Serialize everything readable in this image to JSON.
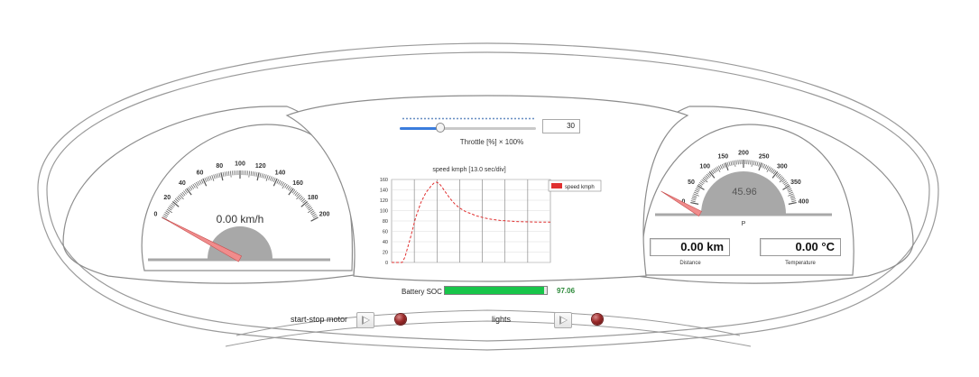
{
  "speedometer": {
    "readout": "0.00 km/h",
    "value": 0,
    "min": 0,
    "max": 200,
    "tick_labels": [
      "0",
      "20",
      "40",
      "60",
      "80",
      "100",
      "120",
      "140",
      "160",
      "180",
      "200"
    ]
  },
  "power_gauge": {
    "readout": "45.96",
    "value": 45.96,
    "min": 0,
    "max": 400,
    "unit_label": "P",
    "tick_labels": [
      "0",
      "50",
      "100",
      "150",
      "200",
      "250",
      "300",
      "350",
      "400"
    ]
  },
  "throttle": {
    "value": 30,
    "max": 100,
    "display": "30",
    "label": "Throttle [%] × 100%"
  },
  "chart_data": {
    "type": "line",
    "title": "speed kmph [13.0 sec/div]",
    "legend": [
      "speed kmph"
    ],
    "legend_placement": "top-right",
    "ylim": [
      0,
      160
    ],
    "yticks": [
      "160",
      "140",
      "120",
      "100",
      "80",
      "60",
      "40",
      "20",
      "0"
    ],
    "grid": true,
    "series": [
      {
        "name": "speed kmph",
        "color": "#e03030",
        "x": [
          0,
          4,
          8,
          10,
          14,
          18,
          22,
          26,
          30,
          32,
          34,
          36,
          38,
          40,
          44,
          48,
          52,
          56,
          60,
          64,
          70,
          76,
          82,
          88,
          94,
          100,
          110,
          120
        ],
        "values": [
          0,
          0,
          0,
          10,
          45,
          85,
          115,
          135,
          148,
          153,
          155,
          152,
          146,
          138,
          124,
          112,
          104,
          98,
          94,
          90,
          86,
          83,
          81,
          80,
          79,
          78.5,
          78,
          78
        ]
      }
    ]
  },
  "distance": {
    "value": "0.00 km",
    "label": "Distance"
  },
  "temperature": {
    "value": "0.00 °C",
    "label": "Temperature"
  },
  "battery": {
    "label": "Battery SOC",
    "value": "97.06",
    "fraction": 0.9706
  },
  "controls": {
    "start_stop_label": "start-stop motor",
    "lights_label": "lights"
  },
  "colors": {
    "needle": "#f08c8c",
    "gauge_hub": "#a8a8a8",
    "battery": "#18c54a",
    "led": "#8b2424"
  }
}
